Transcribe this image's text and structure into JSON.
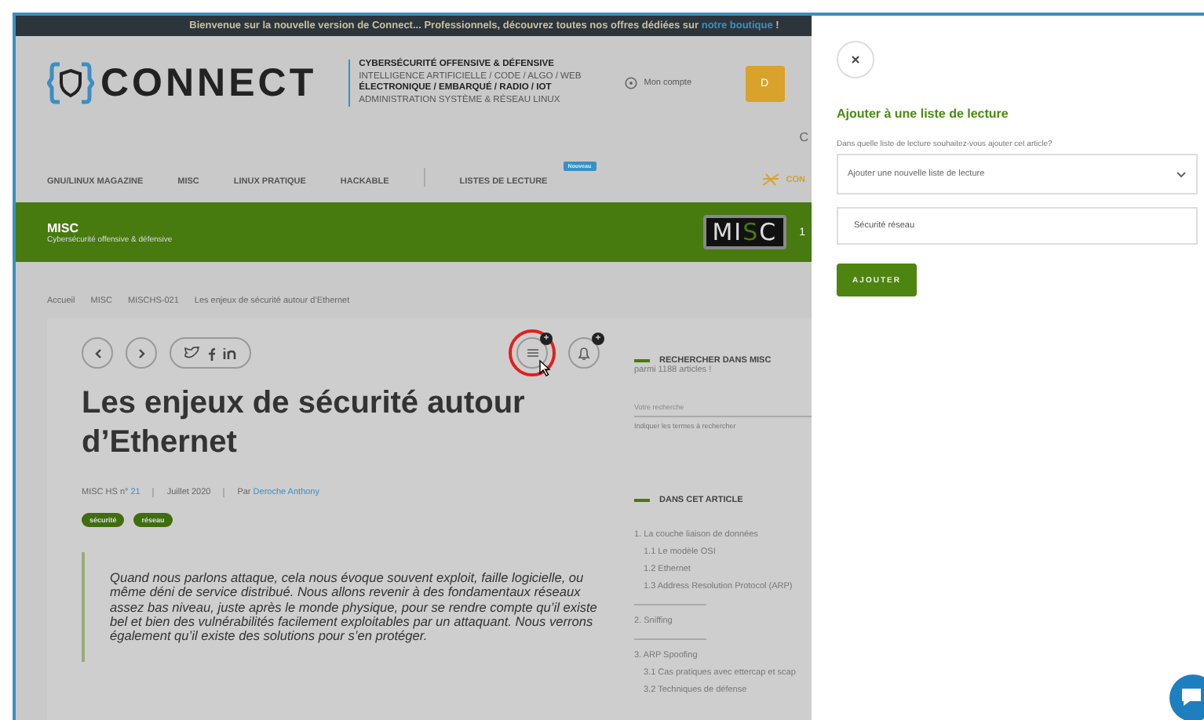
{
  "banner": {
    "text": "Bienvenue sur la nouvelle version de Connect... Professionnels, découvrez toutes nos offres dédiées sur",
    "link": "notre boutique",
    "tail": "!"
  },
  "header": {
    "logo": "CONNECT",
    "tagline": [
      {
        "text": "CYBERSÉCURITÉ OFFENSIVE & DÉFENSIVE",
        "bold": true
      },
      {
        "text": "INTELLIGENCE ARTIFICIELLE / CODE / ALGO / WEB",
        "bold": false
      },
      {
        "text": "ÉLECTRONIQUE / EMBARQUÉ / RADIO / IOT",
        "bold": true
      },
      {
        "text": "ADMINISTRATION SYSTÈME & RÉSEAU LINUX",
        "bold": false
      }
    ],
    "account": "Mon compte",
    "cut_button": "D",
    "cut_text": "C"
  },
  "nav": {
    "items": [
      {
        "label": "GNU/LINUX MAGAZINE"
      },
      {
        "label": "MISC"
      },
      {
        "label": "LINUX PRATIQUE"
      },
      {
        "label": "HACKABLE"
      },
      {
        "label": "LISTES DE LECTURE",
        "badge": "Nouveau"
      }
    ],
    "extra": "CON"
  },
  "section": {
    "title": "MISC",
    "subtitle": "Cybersécurité offensive & défensive",
    "logo": [
      "MI",
      "S",
      "C"
    ],
    "cut_text": "1"
  },
  "breadcrumb": [
    "Accueil",
    "MISC",
    "MISCHS-021",
    "Les enjeux de sécurité autour d’Ethernet"
  ],
  "toolbar": {
    "reading_badge": "+",
    "bell_badge": "+",
    "highlighted": true
  },
  "article": {
    "title": "Les enjeux de sécurité autour d’Ethernet",
    "meta": [
      {
        "parts": [
          {
            "kind": "text",
            "text": "MISC HS n°"
          },
          {
            "kind": "link",
            "text": "21"
          }
        ]
      },
      {
        "parts": [
          {
            "kind": "text",
            "text": "Juillet 2020"
          }
        ]
      },
      {
        "parts": [
          {
            "kind": "text",
            "text": "Par"
          },
          {
            "kind": "link",
            "text": "Deroche Anthony"
          }
        ]
      }
    ],
    "tags": [
      "sécurité",
      "réseau"
    ],
    "abstract": "Quand nous parlons attaque, cela nous évoque souvent exploit, faille logicielle, ou même déni de service distribué. Nous allons revenir à des fondamentaux réseaux assez bas niveau, juste après le monde physique, pour se rendre compte qu’il existe bel et bien des vulnérabilités facilement exploitables par un attaquant. Nous verrons également qu’il existe des solutions pour s’en protéger."
  },
  "sidebar": {
    "search_title": "RECHERCHER DANS MISC",
    "search_subtitle": "parmi 1188 articles !",
    "search_placeholder": "Votre recherche",
    "search_hint": "Indiquer les termes à rechercher",
    "toc_title": "DANS CET ARTICLE",
    "toc": [
      {
        "label": "1. La couche liaison de données",
        "children": [
          {
            "label": "1.1 Le modèle OSI"
          },
          {
            "label": "1.2 Ethernet"
          },
          {
            "label": "1.3 Address Resolution Protocol (ARP)"
          }
        ]
      },
      {
        "label": "2. Sniffing"
      },
      {
        "label": "3. ARP Spoofing",
        "children": [
          {
            "label": "3.1 Cas pratiques avec ettercap et scap"
          },
          {
            "label": "3.2 Techniques de défense"
          }
        ]
      }
    ]
  },
  "panel": {
    "title": "Ajouter à une liste de lecture",
    "question": "Dans quelle liste de lecture souhaitez-vous ajouter cet article?",
    "select": "Ajouter une nouvelle liste de lecture",
    "input": "Sécurité réseau",
    "button": "AJOUTER"
  }
}
